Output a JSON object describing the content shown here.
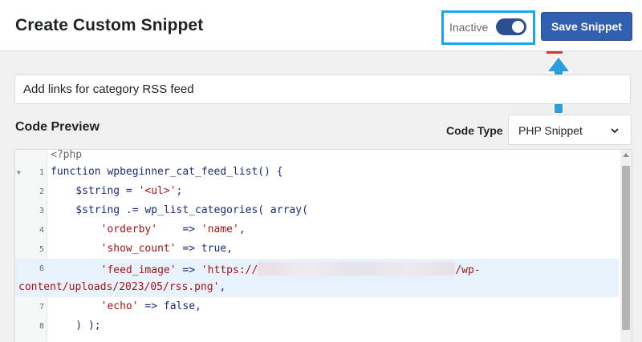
{
  "header": {
    "title": "Create Custom Snippet",
    "toggle_label": "Inactive",
    "save_label": "Save Snippet"
  },
  "snippet": {
    "title_value": "Add links for category RSS feed"
  },
  "code_preview": {
    "section_title": "Code Preview",
    "code_type_label": "Code Type",
    "code_type_value": "PHP Snippet"
  },
  "editor": {
    "opening_tag": "<?php",
    "lines": [
      {
        "num": "1",
        "code": "function wpbeginner_cat_feed_list() {"
      },
      {
        "num": "2",
        "pre": "    $string = ",
        "str": "'<ul>'",
        "post": ";"
      },
      {
        "num": "3",
        "code": "    $string .= wp_list_categories( array("
      },
      {
        "num": "4",
        "pre": "        ",
        "str": "'orderby'",
        "mid": "    => ",
        "str2": "'name'",
        "post": ","
      },
      {
        "num": "5",
        "pre": "        ",
        "str": "'show_count'",
        "post": " => true,"
      },
      {
        "num": "6",
        "pre": "        ",
        "str": "'feed_image'",
        "mid": " => ",
        "str2": "'https://",
        "post_str": "/wp-"
      },
      {
        "num": "",
        "str": "content/uploads/2023/05/rss.png'",
        "post": ","
      },
      {
        "num": "7",
        "pre": "        ",
        "str": "'echo'",
        "post": " => false,"
      },
      {
        "num": "8",
        "code": "    ) );"
      }
    ]
  },
  "colors": {
    "toggle_on": "#2c4f8f",
    "save_button": "#3260b0",
    "highlight_box": "#1ea3e8",
    "arrow": "#2f9be0",
    "string": "#a31515",
    "code_text": "#1f2a7a",
    "line_highlight": "#e8f2fc"
  }
}
